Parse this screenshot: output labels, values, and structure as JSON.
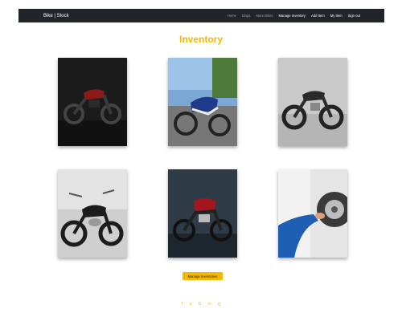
{
  "navbar": {
    "brand": "Bike | Stock",
    "links": [
      {
        "label": "Home"
      },
      {
        "label": "Blogs"
      },
      {
        "label": "More Bikes"
      },
      {
        "label": "Manage Inventory"
      },
      {
        "label": "Add Item"
      },
      {
        "label": "My Item"
      },
      {
        "label": "Sign out"
      }
    ]
  },
  "main": {
    "title": "Inventory",
    "cards": [
      {
        "icon": "motorcycle-photo",
        "bike_color": "#8b1a1a"
      },
      {
        "icon": "motorcycle-photo",
        "bike_color": "#1f3a8a"
      },
      {
        "icon": "motorcycle-photo",
        "bike_color": "#2b2b2b"
      },
      {
        "icon": "motorcycle-photo",
        "bike_color": "#1c1c1c"
      },
      {
        "icon": "motorcycle-photo",
        "bike_color": "#a3161e"
      },
      {
        "icon": "mechanic-photo",
        "bike_color": "#1e5fb3"
      }
    ],
    "manage_button": "Manage Inventories"
  },
  "footer": {
    "social": [
      {
        "icon": "facebook-icon",
        "glyph": "f"
      },
      {
        "icon": "twitter-icon",
        "glyph": "y"
      },
      {
        "icon": "google-icon",
        "glyph": "G"
      },
      {
        "icon": "linkedin-icon",
        "glyph": "in"
      },
      {
        "icon": "github-icon",
        "glyph": "g"
      }
    ]
  },
  "colors": {
    "accent": "#f5b800",
    "navbar_bg": "#212529"
  }
}
